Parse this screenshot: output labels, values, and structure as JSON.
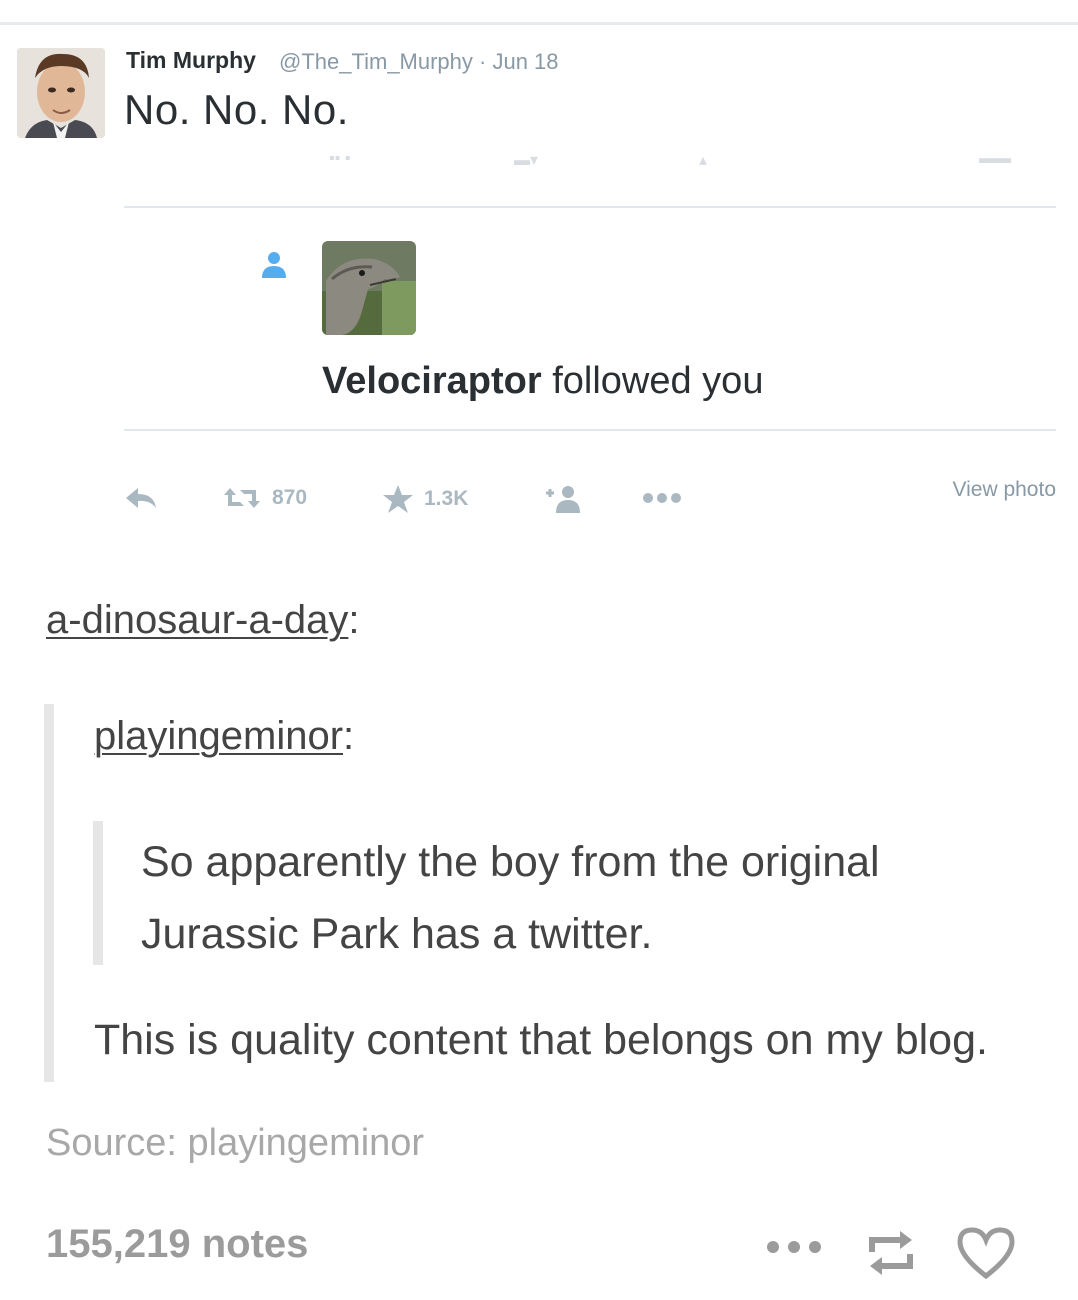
{
  "tweet": {
    "author_name": "Tim Murphy",
    "handle_and_date": "@The_Tim_Murphy · Jun 18",
    "text": "No. No. No."
  },
  "notification": {
    "actor": "Velociraptor",
    "action": "followed you"
  },
  "tweet_actions": {
    "retweet_count": "870",
    "favorite_count": "1.3K",
    "view_photo": "View photo"
  },
  "post": {
    "reblogger": "a-dinosaur-a-day",
    "colon": ":",
    "original_blog": "playingeminor",
    "original_text": "So apparently the boy from the original Jurassic Park has a twitter.",
    "comment": "This is quality content that belongs on my blog.",
    "source": "Source: playingeminor",
    "notes": "155,219 notes"
  },
  "colors": {
    "tweet_icon_gray": "#aab8c2",
    "twitter_blue": "#55acee",
    "tumblr_text": "#444444",
    "muted": "#9b9b9b"
  }
}
